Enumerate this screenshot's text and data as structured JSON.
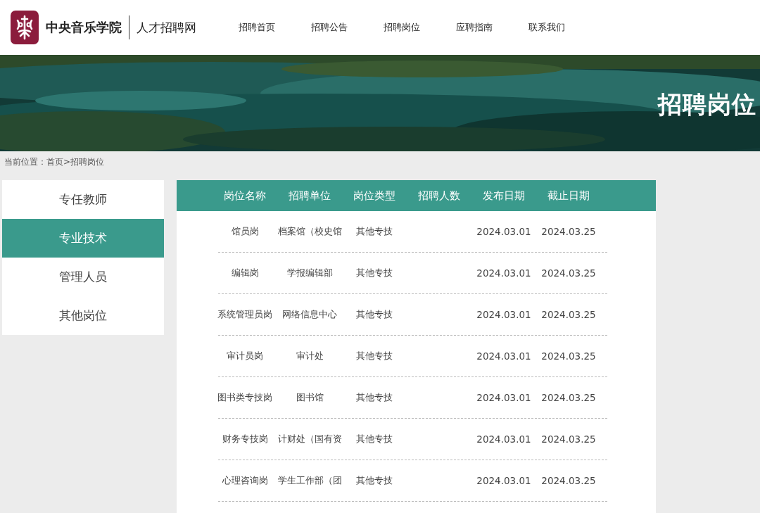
{
  "header": {
    "school_name": "中央音乐学院",
    "site_name": "人才招聘网",
    "nav": [
      {
        "label": "招聘首页",
        "selected": false
      },
      {
        "label": "招聘公告",
        "selected": false
      },
      {
        "label": "招聘岗位",
        "selected": false
      },
      {
        "label": "应聘指南",
        "selected": false
      },
      {
        "label": "联系我们",
        "selected": false
      }
    ]
  },
  "banner": {
    "title": "招聘岗位",
    "kind": "picture"
  },
  "breadcrumb": "当前位置：首页>招聘岗位",
  "sidebar": {
    "items": [
      {
        "label": "专任教师",
        "selected": false
      },
      {
        "label": "专业技术",
        "selected": true
      },
      {
        "label": "管理人员",
        "selected": false
      },
      {
        "label": "其他岗位",
        "selected": false
      }
    ]
  },
  "table": {
    "columns": [
      "岗位名称",
      "招聘单位",
      "岗位类型",
      "招聘人数",
      "发布日期",
      "截止日期"
    ],
    "rows": [
      {
        "position": "馆员岗",
        "unit": "档案馆（校史馆",
        "type": "其他专技",
        "publish_date": "2024.03.01",
        "deadline": "2024.03.25"
      },
      {
        "position": "编辑岗",
        "unit": "学报编辑部",
        "type": "其他专技",
        "publish_date": "2024.03.01",
        "deadline": "2024.03.25"
      },
      {
        "position": "系统管理员岗",
        "unit": "网络信息中心",
        "type": "其他专技",
        "publish_date": "2024.03.01",
        "deadline": "2024.03.25"
      },
      {
        "position": "审计员岗",
        "unit": "审计处",
        "type": "其他专技",
        "publish_date": "2024.03.01",
        "deadline": "2024.03.25"
      },
      {
        "position": "图书类专技岗",
        "unit": "图书馆",
        "type": "其他专技",
        "publish_date": "2024.03.01",
        "deadline": "2024.03.25"
      },
      {
        "position": "财务专技岗",
        "unit": "计财处（国有资",
        "type": "其他专技",
        "publish_date": "2024.03.01",
        "deadline": "2024.03.25"
      },
      {
        "position": "心理咨询岗",
        "unit": "学生工作部（团",
        "type": "其他专技",
        "publish_date": "2024.03.01",
        "deadline": "2024.03.25"
      }
    ]
  }
}
